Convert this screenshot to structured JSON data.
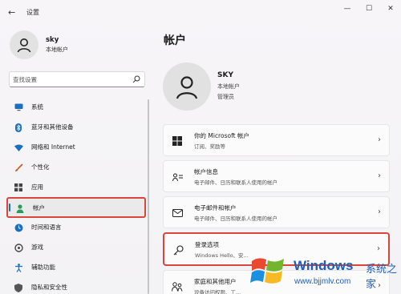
{
  "window": {
    "title": "设置",
    "back_glyph": "←",
    "min_glyph": "—",
    "max_glyph": "☐",
    "close_glyph": "✕"
  },
  "profile": {
    "name": "sky",
    "account_type": "本地帐户"
  },
  "search": {
    "placeholder": "查找设置"
  },
  "sidebar": {
    "items": [
      {
        "label": "系统",
        "icon": "monitor-icon",
        "color": "#1a6fc1"
      },
      {
        "label": "蓝牙和其他设备",
        "icon": "bluetooth-icon",
        "color": "#1a6fc1"
      },
      {
        "label": "网络和 Internet",
        "icon": "wifi-icon",
        "color": "#1a6fc1"
      },
      {
        "label": "个性化",
        "icon": "brush-icon",
        "color": "#c45a1c"
      },
      {
        "label": "应用",
        "icon": "apps-icon",
        "color": "#444444"
      },
      {
        "label": "帐户",
        "icon": "person-icon",
        "color": "#2c9a5b",
        "active": true
      },
      {
        "label": "时间和语言",
        "icon": "globe-clock-icon",
        "color": "#1a6fc1"
      },
      {
        "label": "游戏",
        "icon": "gamepad-icon",
        "color": "#444444"
      },
      {
        "label": "辅助功能",
        "icon": "accessibility-icon",
        "color": "#1a6fc1"
      },
      {
        "label": "隐私和安全性",
        "icon": "shield-icon",
        "color": "#555555"
      }
    ]
  },
  "main": {
    "title": "帐户",
    "user": {
      "name": "SKY",
      "account_type": "本地帐户",
      "role": "管理员"
    },
    "cards": [
      {
        "title": "你的 Microsoft 帐户",
        "subtitle": "订阅、奖励等",
        "icon": "windows-icon"
      },
      {
        "title": "帐户信息",
        "subtitle": "电子邮件、日历和联系人使用的帐户",
        "icon": "account-info-icon"
      },
      {
        "title": "电子邮件和帐户",
        "subtitle": "电子邮件、日历和联系人使用的帐户",
        "icon": "mail-icon"
      },
      {
        "title": "登录选项",
        "subtitle": "Windows Hello、安...",
        "icon": "key-icon",
        "highlight": true
      },
      {
        "title": "家庭和其他用户",
        "subtitle": "设备访问权限、工...",
        "icon": "family-icon"
      }
    ],
    "chevron": "›"
  },
  "watermark": {
    "brand": "Windows",
    "cn": "系统之家",
    "url": "www.bjjmlv.com"
  }
}
